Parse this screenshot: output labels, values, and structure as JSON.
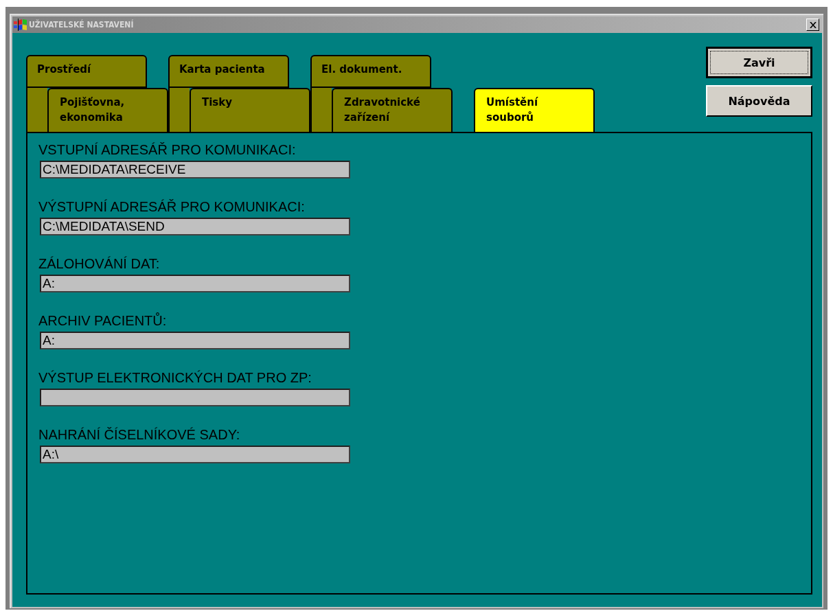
{
  "window": {
    "title": "UŽIVATELSKÉ NASTAVENÍ"
  },
  "tab_rows": [
    {
      "tabs": [
        {
          "label": "Prostředí",
          "selected": false
        },
        {
          "label": "Karta pacienta",
          "selected": false
        },
        {
          "label": "El. dokument.",
          "selected": false
        }
      ]
    },
    {
      "tabs": [
        {
          "label": "Pojišťovna, ekonomika",
          "selected": false
        },
        {
          "label": "Tisky",
          "selected": false
        },
        {
          "label": "Zdravotnické zařízení",
          "selected": false
        },
        {
          "label": "Umístění souborů",
          "selected": true
        }
      ]
    }
  ],
  "buttons": [
    {
      "label": "Zavři",
      "focused": true
    },
    {
      "label": "Nápověda",
      "focused": false
    }
  ],
  "fields": [
    {
      "label": "VSTUPNÍ ADRESÁŘ PRO KOMUNIKACI:",
      "value": "C:\\MEDIDATA\\RECEIVE"
    },
    {
      "label": "VÝSTUPNÍ ADRESÁŘ PRO KOMUNIKACI:",
      "value": "C:\\MEDIDATA\\SEND"
    },
    {
      "label": "ZÁLOHOVÁNÍ DAT:",
      "value": "A:"
    },
    {
      "label": "ARCHIV PACIENTŮ:",
      "value": "A:"
    },
    {
      "label": "VÝSTUP ELEKTRONICKÝCH DAT PRO ZP:"
    },
    {
      "label": "NAHRÁNÍ ČÍSELNÍKOVÉ SADY:",
      "value": "A:\\"
    }
  ]
}
